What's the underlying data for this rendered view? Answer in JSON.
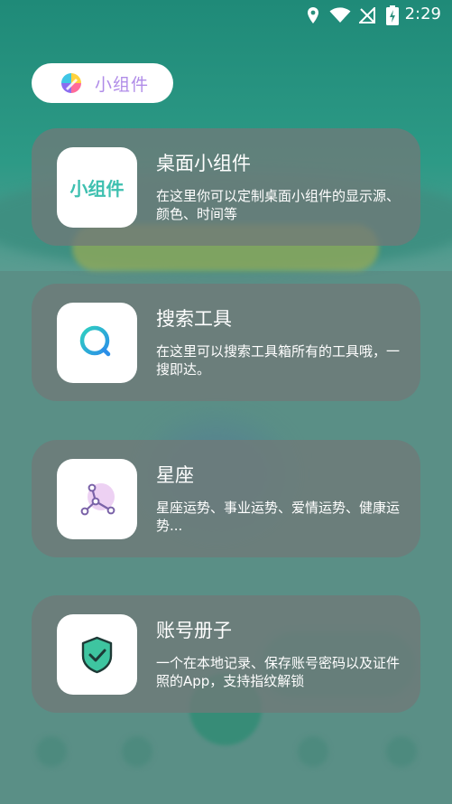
{
  "status_bar": {
    "time": "2:29"
  },
  "header_chip": {
    "label": "小组件"
  },
  "cards": [
    {
      "title": "桌面小组件",
      "description": "在这里你可以定制桌面小组件的显示源、颜色、时间等",
      "tile_text": "小组件"
    },
    {
      "title": "搜索工具",
      "description": "在这里可以搜索工具箱所有的工具哦，一搜即达。"
    },
    {
      "title": "星座",
      "description": "星座运势、事业运势、爱情运势、健康运势..."
    },
    {
      "title": "账号册子",
      "description": "一个在本地记录、保存账号密码以及证件照的App，支持指纹解锁"
    }
  ],
  "colors": {
    "card_background": "#6f7a78",
    "accent_teal": "#3ec0b0",
    "chip_text": "#b08ce8"
  }
}
